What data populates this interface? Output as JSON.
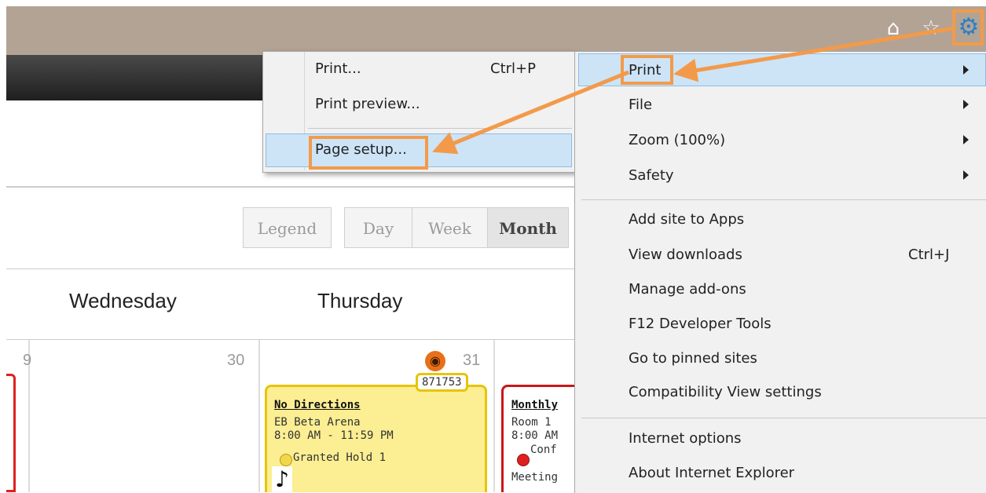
{
  "toolbar": {
    "home_icon": "home-icon",
    "favorites_icon": "star-icon",
    "tools_icon": "gear-icon"
  },
  "calendar": {
    "view_buttons": [
      "Legend",
      "Day",
      "Week",
      "Month"
    ],
    "active_view": "Month",
    "day_headers": [
      "Wednesday",
      "Thursday"
    ],
    "partial_prev_num": "9",
    "day_numbers": [
      "30",
      "31"
    ],
    "event1": {
      "id": "871753",
      "title": "No Directions",
      "location": "EB Beta Arena",
      "time": "8:00 AM - 11:59 PM",
      "status": "Granted Hold 1",
      "status_color": "#f0d84a",
      "icon": "music-note-icon",
      "badge_icon": "pumpkin-icon"
    },
    "event2": {
      "title": "Monthly",
      "location": "Room 1",
      "time": "8:00 AM",
      "status": "Conf",
      "type": "Meeting",
      "status_color": "#e02020"
    }
  },
  "tools_menu": {
    "items": [
      {
        "label": "Print",
        "submenu": true
      },
      {
        "label": "File",
        "submenu": true
      },
      {
        "label": "Zoom (100%)",
        "submenu": true
      },
      {
        "label": "Safety",
        "submenu": true
      },
      {
        "label": "Add site to Apps"
      },
      {
        "label": "View downloads",
        "shortcut": "Ctrl+J"
      },
      {
        "label": "Manage add-ons"
      },
      {
        "label": "F12 Developer Tools"
      },
      {
        "label": "Go to pinned sites"
      },
      {
        "label": "Compatibility View settings"
      },
      {
        "label": "Internet options"
      },
      {
        "label": "About Internet Explorer"
      }
    ]
  },
  "print_submenu": {
    "items": [
      {
        "label": "Print...",
        "shortcut": "Ctrl+P"
      },
      {
        "label": "Print preview..."
      },
      {
        "label": "Page setup..."
      }
    ]
  },
  "colors": {
    "highlight": "#f39a4a",
    "chrome": "#b3a394",
    "menu_bg": "#f1f1f1",
    "menu_hover": "#cde4f7"
  }
}
